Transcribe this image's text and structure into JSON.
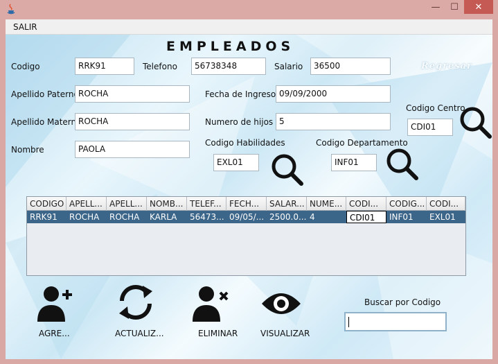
{
  "menu": {
    "salir": "SALIR"
  },
  "window": {
    "min": "—",
    "max": "☐",
    "close": "✕"
  },
  "form": {
    "title": "EMPLEADOS",
    "regresar": "Regresar",
    "codigo": {
      "label": "Codigo",
      "value": "RRK91"
    },
    "telefono": {
      "label": "Telefono",
      "value": "56738348"
    },
    "salario": {
      "label": "Salario",
      "value": "36500"
    },
    "apellido_paterno": {
      "label": "Apellido Paterno",
      "value": "ROCHA"
    },
    "fecha_ingreso": {
      "label": "Fecha de Ingreso",
      "value": "09/09/2000"
    },
    "codigo_centro": {
      "label": "Codigo Centro",
      "value": "CDI01"
    },
    "apellido_materno": {
      "label": "Apellido Materno",
      "value": "ROCHA"
    },
    "numero_hijos": {
      "label": "Numero de hijos",
      "value": "5"
    },
    "nombre": {
      "label": "Nombre",
      "value": "PAOLA"
    },
    "codigo_habilidades": {
      "label": "Codigo Habilidades",
      "value": "EXL01"
    },
    "codigo_departamento": {
      "label": "Codigo Departamento",
      "value": "INF01"
    }
  },
  "table": {
    "columns": [
      "CODIGO",
      "APELL...",
      "APELL...",
      "NOMB...",
      "TELEF...",
      "FECH...",
      "SALAR...",
      "NUME...",
      "CODI...",
      "CODIG...",
      "CODI..."
    ],
    "rows": [
      [
        "RRK91",
        "ROCHA",
        "ROCHA",
        "KARLA",
        "56473...",
        "09/05/...",
        "2500.0...",
        "4",
        "CDI01",
        "INF01",
        "EXL01"
      ]
    ]
  },
  "actions": {
    "agregar": "AGRE...",
    "actualizar": "ACTUALIZ...",
    "eliminar": "ELIMINAR",
    "visualizar": "VISUALIZAR"
  },
  "buscar": {
    "label": "Buscar por Codigo",
    "value": ""
  }
}
